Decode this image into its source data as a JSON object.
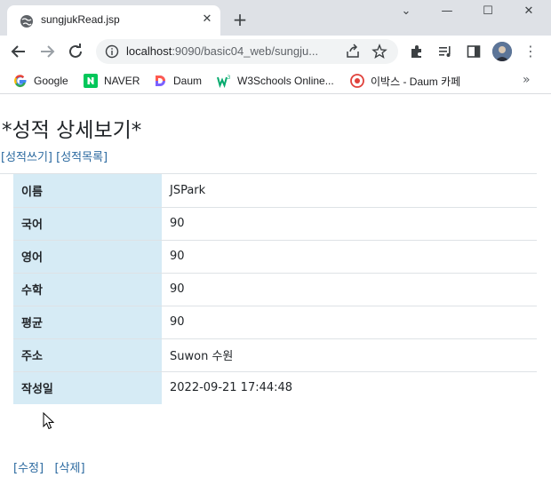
{
  "browser": {
    "tab_title": "sungjukRead.jsp",
    "tab_close": "✕",
    "new_tab": "+",
    "window_controls": [
      "⌄",
      "—",
      "☐",
      "✕"
    ],
    "url_host": "localhost",
    "url_rest": ":9090/basic04_web/sungju...",
    "bookmarks": [
      {
        "label": "Google"
      },
      {
        "label": "NAVER"
      },
      {
        "label": "Daum"
      },
      {
        "label": "W3Schools Online..."
      },
      {
        "label": "이박스 - Daum 카페"
      }
    ],
    "more": "»"
  },
  "page": {
    "title": "*성적 상세보기*",
    "link_write": "[성적쓰기]",
    "link_list": "[성적목록]",
    "rows": [
      {
        "label": "이름",
        "value": "JSPark"
      },
      {
        "label": "국어",
        "value": "90"
      },
      {
        "label": "영어",
        "value": "90"
      },
      {
        "label": "수학",
        "value": "90"
      },
      {
        "label": "평균",
        "value": "90"
      },
      {
        "label": "주소",
        "value": "Suwon 수원"
      },
      {
        "label": "작성일",
        "value": "2022-09-21 17:44:48"
      }
    ],
    "link_edit": "[수정]",
    "link_delete": "[삭제]"
  },
  "colors": {
    "label_bg": "#d6ebf5",
    "link": "#2c6aa0",
    "chrome_bg": "#dee1e6"
  }
}
